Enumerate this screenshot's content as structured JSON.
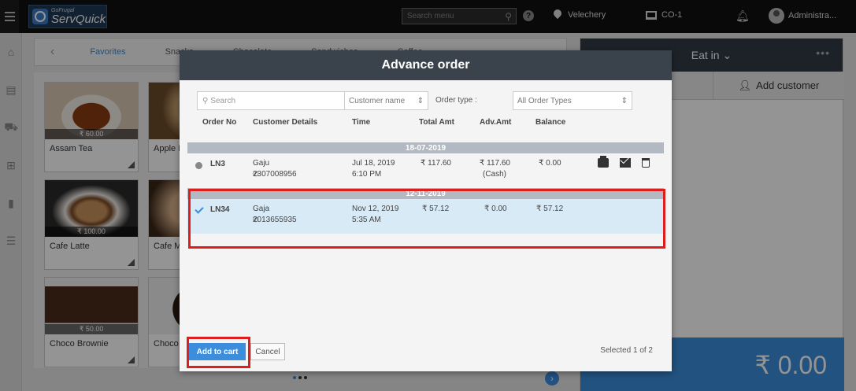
{
  "app": {
    "logo_small": "GoFrugal",
    "logo_main": "ServQuick",
    "search_placeholder": "Search menu",
    "location": "Velechery",
    "terminal": "CO-1",
    "user": "Administra..."
  },
  "categories": {
    "favorites": "Favorites",
    "items": [
      "Snacks",
      "Chocolate",
      "Sandwiches",
      "Coffee"
    ]
  },
  "products": [
    {
      "name": "Assam Tea",
      "price": "₹ 60.00"
    },
    {
      "name": "Apple M",
      "price": ""
    },
    {
      "name": "Cafe Latte",
      "price": "₹ 100.00"
    },
    {
      "name": "Cafe M",
      "price": ""
    },
    {
      "name": "Choco Brownie",
      "price": "₹ 50.00"
    },
    {
      "name": "Choco",
      "price": ""
    }
  ],
  "right_panel": {
    "mode": "Eat in",
    "add_customer": "Add customer",
    "total": "₹ 0.00"
  },
  "modal": {
    "title": "Advance order",
    "search_placeholder": "Search",
    "customer_filter": "Customer name",
    "order_type_label": "Order type :",
    "order_type_value": "All Order Types",
    "columns": {
      "order_no": "Order No",
      "customer": "Customer Details",
      "time": "Time",
      "total": "Total Amt",
      "adv": "Adv.Amt",
      "balance": "Balance"
    },
    "groups": [
      {
        "date": "18-07-2019",
        "order": {
          "order_no": "LN3",
          "customer_name": "Gaju",
          "phone": "2307008956",
          "date": "Jul 18, 2019",
          "time": "6:10 PM",
          "total": "₹ 117.60",
          "adv": "₹ 117.60",
          "adv_mode": "(Cash)",
          "balance": "₹ 0.00",
          "selected": false
        }
      },
      {
        "date": "12-11-2019",
        "order": {
          "order_no": "LN34",
          "customer_name": "Gaja",
          "phone": "2013655935",
          "date": "Nov 12, 2019",
          "time": "5:35 AM",
          "total": "₹ 57.12",
          "adv": "₹ 0.00",
          "adv_mode": "",
          "balance": "₹ 57.12",
          "selected": true
        }
      }
    ],
    "add_to_cart": "Add to cart",
    "cancel": "Cancel",
    "selected_count": "Selected 1 of 2"
  },
  "colors": {
    "accent": "#3c8ddb",
    "highlight": "#e01d1d",
    "modal_header": "#3a434c"
  }
}
